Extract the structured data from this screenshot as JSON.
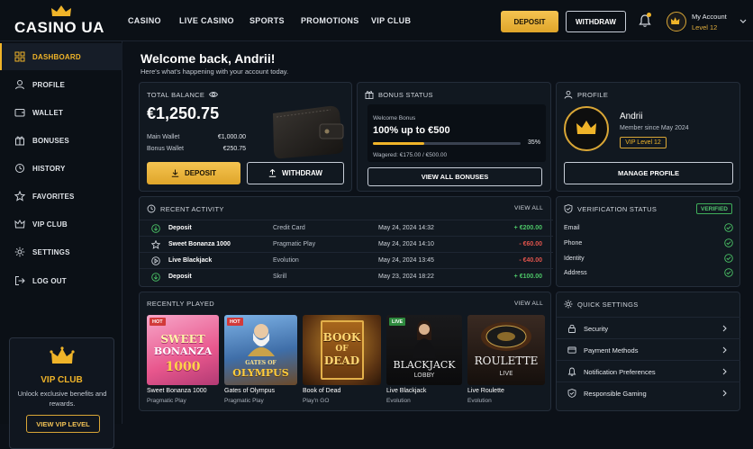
{
  "brand": {
    "name": "CASINO UA"
  },
  "nav": {
    "items": [
      "CASINO",
      "LIVE CASINO",
      "SPORTS",
      "PROMOTIONS",
      "VIP CLUB"
    ]
  },
  "header": {
    "deposit_label": "DEPOSIT",
    "withdraw_label": "WITHDRAW",
    "account_label": "My Account",
    "account_level": "Level 12"
  },
  "sidebar": {
    "items": [
      {
        "label": "DASHBOARD",
        "icon": "grid-icon",
        "active": true
      },
      {
        "label": "PROFILE",
        "icon": "user-icon"
      },
      {
        "label": "WALLET",
        "icon": "wallet-icon"
      },
      {
        "label": "BONUSES",
        "icon": "gift-icon"
      },
      {
        "label": "HISTORY",
        "icon": "history-icon"
      },
      {
        "label": "FAVORITES",
        "icon": "star-icon"
      },
      {
        "label": "VIP CLUB",
        "icon": "crown-icon"
      },
      {
        "label": "SETTINGS",
        "icon": "gear-icon"
      },
      {
        "label": "LOG OUT",
        "icon": "logout-icon"
      }
    ],
    "vip": {
      "title": "VIP CLUB",
      "desc": "Unlock exclusive benefits and rewards.",
      "button": "VIEW VIP LEVEL"
    }
  },
  "welcome": {
    "title": "Welcome back, Andrii!",
    "subtitle": "Here's what's happening with your account today."
  },
  "balance": {
    "title": "TOTAL BALANCE",
    "amount": "€1,250.75",
    "main_label": "Main Wallet",
    "main_value": "€1,000.00",
    "bonus_label": "Bonus Wallet",
    "bonus_value": "€250.75",
    "deposit": "DEPOSIT",
    "withdraw": "WITHDRAW"
  },
  "bonus": {
    "title": "BONUS STATUS",
    "label": "Welcome Bonus",
    "offer": "100% up to €500",
    "progress": 0.35,
    "percent": "35%",
    "wagered": "Wagered: €175.00 / €500.00",
    "button": "VIEW ALL BONUSES"
  },
  "profile": {
    "title": "PROFILE",
    "name": "Andrii",
    "since": "Member since May 2024",
    "level": "VIP Level 12",
    "button": "MANAGE PROFILE"
  },
  "activity": {
    "title": "RECENT ACTIVITY",
    "view_all": "VIEW ALL",
    "rows": [
      {
        "icon": "deposit-icon",
        "name": "Deposit",
        "method": "Credit Card",
        "date": "May 24, 2024 14:32",
        "amount": "+ €200.00",
        "color": "#4cc567"
      },
      {
        "icon": "star-icon",
        "name": "Sweet Bonanza 1000",
        "method": "Pragmatic Play",
        "date": "May 24, 2024 14:10",
        "amount": "- €60.00",
        "color": "#e0544c"
      },
      {
        "icon": "play-icon",
        "name": "Live Blackjack",
        "method": "Evolution",
        "date": "May 24, 2024 13:45",
        "amount": "- €40.00",
        "color": "#e0544c"
      },
      {
        "icon": "deposit-icon",
        "name": "Deposit",
        "method": "Skrill",
        "date": "May 23, 2024 18:22",
        "amount": "+ €100.00",
        "color": "#4cc567"
      }
    ]
  },
  "verification": {
    "title": "VERIFICATION STATUS",
    "badge": "VERIFIED",
    "items": [
      "Email",
      "Phone",
      "Identity",
      "Address"
    ]
  },
  "recent": {
    "title": "RECENTLY PLAYED",
    "view_all": "VIEW ALL",
    "games": [
      {
        "name": "Sweet Bonanza 1000",
        "provider": "Pragmatic Play",
        "badge": "HOT",
        "art1": "SWEET",
        "art2": "BONANZA",
        "art3": "1000"
      },
      {
        "name": "Gates of Olympus",
        "provider": "Pragmatic Play",
        "badge": "HOT",
        "art1": "GATES OF",
        "art2": "OLYMPUS",
        "art3": ""
      },
      {
        "name": "Book of Dead",
        "provider": "Play'n GO",
        "badge": "",
        "art1": "BOOK",
        "art2": "OF",
        "art3": "DEAD"
      },
      {
        "name": "Live Blackjack",
        "provider": "Evolution",
        "badge": "LIVE",
        "art1": "BLACKJACK",
        "art2": "LOBBY",
        "art3": ""
      },
      {
        "name": "Live Roulette",
        "provider": "Evolution",
        "badge": "",
        "art1": "ROULETTE",
        "art2": "LIVE",
        "art3": ""
      }
    ]
  },
  "quick": {
    "title": "QUICK SETTINGS",
    "items": [
      {
        "label": "Security",
        "icon": "lock-icon"
      },
      {
        "label": "Payment Methods",
        "icon": "card-icon"
      },
      {
        "label": "Notification Preferences",
        "icon": "bell-icon"
      },
      {
        "label": "Responsible Gaming",
        "icon": "shield-icon"
      }
    ]
  },
  "colors": {
    "accent": "#f0b429",
    "positive": "#4cc567",
    "negative": "#e0544c",
    "background": "#0c1118"
  }
}
